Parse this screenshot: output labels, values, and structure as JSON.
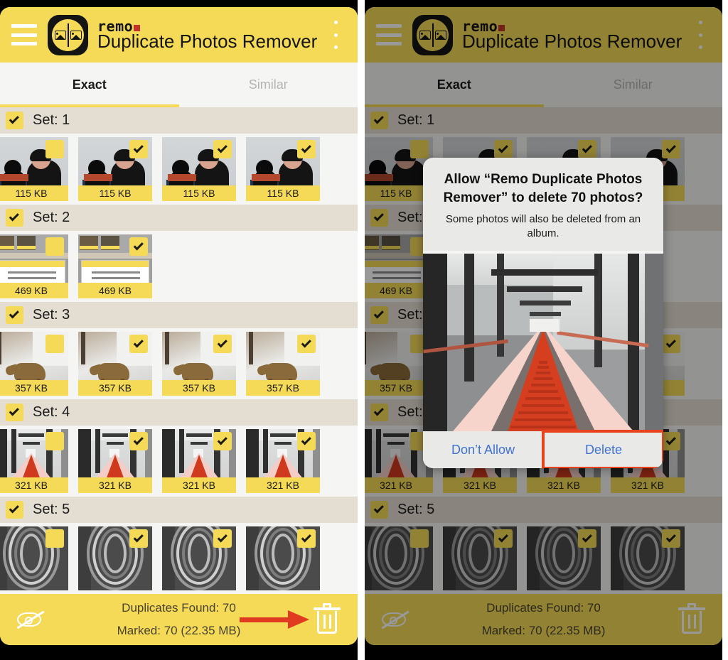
{
  "app": {
    "brand": "remo",
    "title": "Duplicate Photos Remover",
    "menu_icon": "hamburger-menu-icon",
    "overflow_icon": "kebab-menu-icon"
  },
  "tabs": [
    {
      "label": "Exact",
      "active": true
    },
    {
      "label": "Similar",
      "active": false
    }
  ],
  "sets": [
    {
      "label": "Set: 1",
      "checked": true,
      "art": "art-couple",
      "items": [
        {
          "size": "115 KB",
          "checked": false
        },
        {
          "size": "115 KB",
          "checked": true
        },
        {
          "size": "115 KB",
          "checked": true
        },
        {
          "size": "115 KB",
          "checked": true
        }
      ]
    },
    {
      "label": "Set: 2",
      "checked": true,
      "art": "art-shot",
      "items": [
        {
          "size": "469 KB",
          "checked": false
        },
        {
          "size": "469 KB",
          "checked": true
        }
      ]
    },
    {
      "label": "Set: 3",
      "checked": true,
      "art": "art-deer",
      "items": [
        {
          "size": "357 KB",
          "checked": false
        },
        {
          "size": "357 KB",
          "checked": true
        },
        {
          "size": "357 KB",
          "checked": true
        },
        {
          "size": "357 KB",
          "checked": true
        }
      ]
    },
    {
      "label": "Set: 4",
      "checked": true,
      "art": "art-corridor",
      "items": [
        {
          "size": "321 KB",
          "checked": false
        },
        {
          "size": "321 KB",
          "checked": true
        },
        {
          "size": "321 KB",
          "checked": true
        },
        {
          "size": "321 KB",
          "checked": true
        }
      ]
    },
    {
      "label": "Set: 5",
      "checked": true,
      "art": "art-spiral",
      "items": [
        {
          "size": "",
          "checked": false
        },
        {
          "size": "",
          "checked": true
        },
        {
          "size": "",
          "checked": true
        },
        {
          "size": "",
          "checked": true
        }
      ]
    }
  ],
  "bottom_bar": {
    "hide_icon": "eye-slash-icon",
    "duplicates_found": "Duplicates Found: 70",
    "marked": "Marked: 70 (22.35 MB)",
    "delete_icon": "trash-icon",
    "annotation_arrow": "red-arrow-pointing-to-trash"
  },
  "dialog": {
    "title": "Allow “Remo Duplicate Photos Remover” to delete 70 photos?",
    "subtitle": "Some photos will also be deleted from an album.",
    "preview_image": "corridor-with-red-carpet-photo",
    "buttons": [
      {
        "label": "Don’t Allow",
        "highlighted": false
      },
      {
        "label": "Delete",
        "highlighted": true
      }
    ]
  },
  "colors": {
    "accent_yellow": "#f4da57",
    "set_header": "#e4ddd2",
    "dialog_bg": "#e9e9e7",
    "link_blue": "#3f72d4",
    "annotation_red": "#e03a20",
    "highlight_red": "#e8421f",
    "brand_dot_red": "#c4342b"
  }
}
